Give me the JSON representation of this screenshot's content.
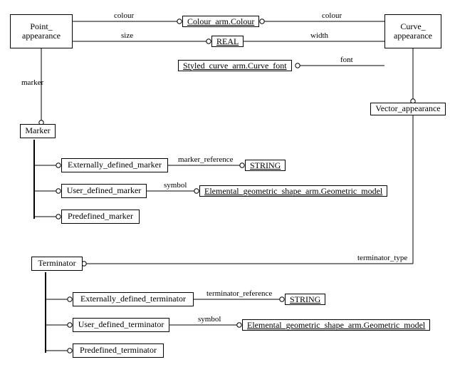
{
  "entities": {
    "point_appearance": "Point_\nappearance",
    "curve_appearance": "Curve_\nappearance",
    "vector_appearance": "Vector_appearance",
    "marker": "Marker",
    "externally_defined_marker": "Externally_defined_marker",
    "user_defined_marker": "User_defined_marker",
    "predefined_marker": "Predefined_marker",
    "terminator": "Terminator",
    "externally_defined_terminator": "Externally_defined_terminator",
    "user_defined_terminator": "User_defined_terminator",
    "predefined_terminator": "Predefined_terminator"
  },
  "refs": {
    "colour": "Colour_arm.Colour",
    "real": "REAL",
    "curve_font": "Styled_curve_arm.Curve_font",
    "string1": "STRING",
    "geom_model1": "Elemental_geometric_shape_arm.Geometric_model",
    "string2": "STRING",
    "geom_model2": "Elemental_geometric_shape_arm.Geometric_model"
  },
  "labels": {
    "colour_left": "colour",
    "colour_right": "colour",
    "size": "size",
    "width": "width",
    "font": "font",
    "marker_attr": "marker",
    "marker_reference": "marker_reference",
    "symbol1": "symbol",
    "terminator_type": "terminator_type",
    "terminator_reference": "terminator_reference",
    "symbol2": "symbol"
  }
}
